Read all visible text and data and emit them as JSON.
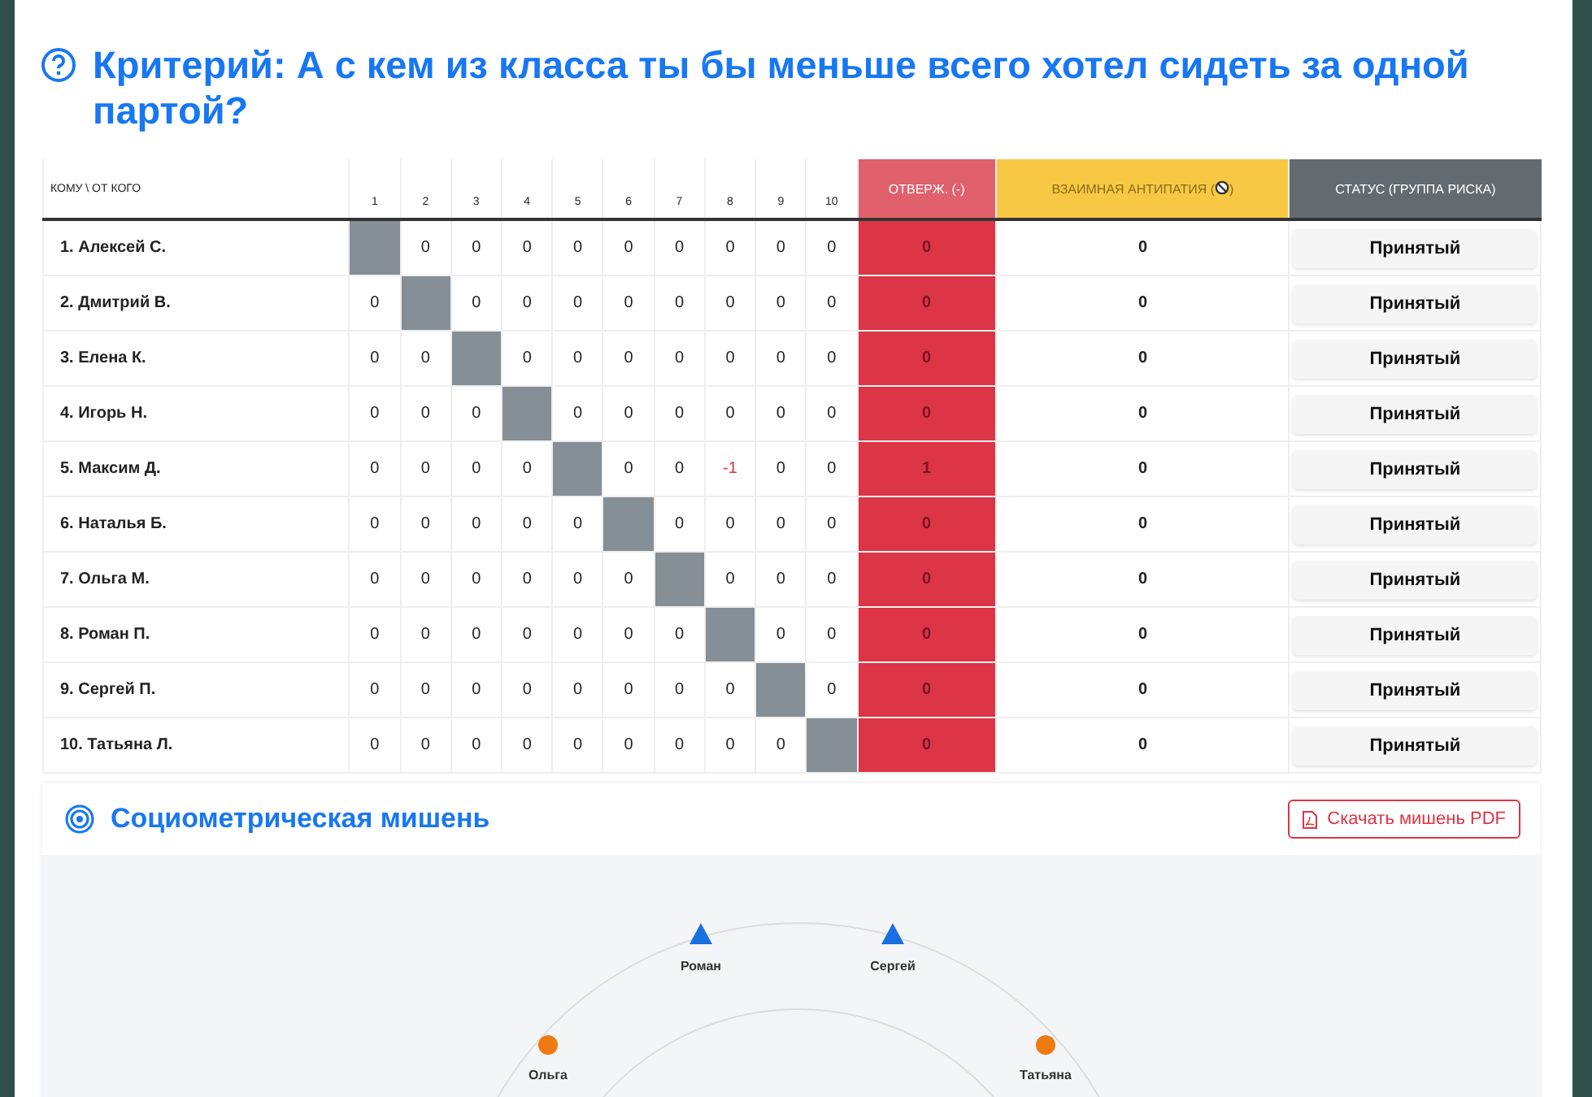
{
  "title": "Критерий: А с кем из класса ты бы меньше всего хотел сидеть за одной партой?",
  "table": {
    "columns": {
      "name": "КОМУ \\ ОТ КОГО",
      "numbers": [
        "1",
        "2",
        "3",
        "4",
        "5",
        "6",
        "7",
        "8",
        "9",
        "10"
      ],
      "rejections": "ОТВЕРЖ. (-)",
      "antipathy": "ВЗАИМНАЯ АНТИПАТИЯ (",
      "antipathy_end": ")",
      "status": "СТАТУС (ГРУППА РИСКА)"
    },
    "rows": [
      {
        "name": "1. Алексей С.",
        "cells": [
          {
            "kind": "self"
          },
          {
            "kind": "value",
            "text": "0"
          },
          {
            "kind": "value",
            "text": "0"
          },
          {
            "kind": "value",
            "text": "0"
          },
          {
            "kind": "value",
            "text": "0"
          },
          {
            "kind": "value",
            "text": "0"
          },
          {
            "kind": "value",
            "text": "0"
          },
          {
            "kind": "value",
            "text": "0"
          },
          {
            "kind": "value",
            "text": "0"
          },
          {
            "kind": "value",
            "text": "0"
          }
        ],
        "rejections": "0",
        "antipathy": "0",
        "status": "Принятый"
      },
      {
        "name": "2. Дмитрий В.",
        "cells": [
          {
            "kind": "value",
            "text": "0"
          },
          {
            "kind": "self"
          },
          {
            "kind": "value",
            "text": "0"
          },
          {
            "kind": "value",
            "text": "0"
          },
          {
            "kind": "value",
            "text": "0"
          },
          {
            "kind": "value",
            "text": "0"
          },
          {
            "kind": "value",
            "text": "0"
          },
          {
            "kind": "value",
            "text": "0"
          },
          {
            "kind": "value",
            "text": "0"
          },
          {
            "kind": "value",
            "text": "0"
          }
        ],
        "rejections": "0",
        "antipathy": "0",
        "status": "Принятый"
      },
      {
        "name": "3. Елена К.",
        "cells": [
          {
            "kind": "value",
            "text": "0"
          },
          {
            "kind": "value",
            "text": "0"
          },
          {
            "kind": "self"
          },
          {
            "kind": "value",
            "text": "0"
          },
          {
            "kind": "value",
            "text": "0"
          },
          {
            "kind": "value",
            "text": "0"
          },
          {
            "kind": "value",
            "text": "0"
          },
          {
            "kind": "value",
            "text": "0"
          },
          {
            "kind": "value",
            "text": "0"
          },
          {
            "kind": "value",
            "text": "0"
          }
        ],
        "rejections": "0",
        "antipathy": "0",
        "status": "Принятый"
      },
      {
        "name": "4. Игорь Н.",
        "cells": [
          {
            "kind": "value",
            "text": "0"
          },
          {
            "kind": "value",
            "text": "0"
          },
          {
            "kind": "value",
            "text": "0"
          },
          {
            "kind": "self"
          },
          {
            "kind": "value",
            "text": "0"
          },
          {
            "kind": "value",
            "text": "0"
          },
          {
            "kind": "value",
            "text": "0"
          },
          {
            "kind": "value",
            "text": "0"
          },
          {
            "kind": "value",
            "text": "0"
          },
          {
            "kind": "value",
            "text": "0"
          }
        ],
        "rejections": "0",
        "antipathy": "0",
        "status": "Принятый"
      },
      {
        "name": "5. Максим Д.",
        "cells": [
          {
            "kind": "value",
            "text": "0"
          },
          {
            "kind": "value",
            "text": "0"
          },
          {
            "kind": "value",
            "text": "0"
          },
          {
            "kind": "value",
            "text": "0"
          },
          {
            "kind": "self"
          },
          {
            "kind": "value",
            "text": "0"
          },
          {
            "kind": "value",
            "text": "0"
          },
          {
            "kind": "negative",
            "text": "-1"
          },
          {
            "kind": "value",
            "text": "0"
          },
          {
            "kind": "value",
            "text": "0"
          }
        ],
        "rejections": "1",
        "antipathy": "0",
        "status": "Принятый"
      },
      {
        "name": "6. Наталья Б.",
        "cells": [
          {
            "kind": "value",
            "text": "0"
          },
          {
            "kind": "value",
            "text": "0"
          },
          {
            "kind": "value",
            "text": "0"
          },
          {
            "kind": "value",
            "text": "0"
          },
          {
            "kind": "value",
            "text": "0"
          },
          {
            "kind": "self"
          },
          {
            "kind": "value",
            "text": "0"
          },
          {
            "kind": "value",
            "text": "0"
          },
          {
            "kind": "value",
            "text": "0"
          },
          {
            "kind": "value",
            "text": "0"
          }
        ],
        "rejections": "0",
        "antipathy": "0",
        "status": "Принятый"
      },
      {
        "name": "7. Ольга М.",
        "cells": [
          {
            "kind": "value",
            "text": "0"
          },
          {
            "kind": "value",
            "text": "0"
          },
          {
            "kind": "value",
            "text": "0"
          },
          {
            "kind": "value",
            "text": "0"
          },
          {
            "kind": "value",
            "text": "0"
          },
          {
            "kind": "value",
            "text": "0"
          },
          {
            "kind": "self"
          },
          {
            "kind": "value",
            "text": "0"
          },
          {
            "kind": "value",
            "text": "0"
          },
          {
            "kind": "value",
            "text": "0"
          }
        ],
        "rejections": "0",
        "antipathy": "0",
        "status": "Принятый"
      },
      {
        "name": "8. Роман П.",
        "cells": [
          {
            "kind": "value",
            "text": "0"
          },
          {
            "kind": "value",
            "text": "0"
          },
          {
            "kind": "value",
            "text": "0"
          },
          {
            "kind": "value",
            "text": "0"
          },
          {
            "kind": "value",
            "text": "0"
          },
          {
            "kind": "value",
            "text": "0"
          },
          {
            "kind": "value",
            "text": "0"
          },
          {
            "kind": "self"
          },
          {
            "kind": "value",
            "text": "0"
          },
          {
            "kind": "value",
            "text": "0"
          }
        ],
        "rejections": "0",
        "antipathy": "0",
        "status": "Принятый"
      },
      {
        "name": "9. Сергей П.",
        "cells": [
          {
            "kind": "value",
            "text": "0"
          },
          {
            "kind": "value",
            "text": "0"
          },
          {
            "kind": "value",
            "text": "0"
          },
          {
            "kind": "value",
            "text": "0"
          },
          {
            "kind": "value",
            "text": "0"
          },
          {
            "kind": "value",
            "text": "0"
          },
          {
            "kind": "value",
            "text": "0"
          },
          {
            "kind": "value",
            "text": "0"
          },
          {
            "kind": "self"
          },
          {
            "kind": "value",
            "text": "0"
          }
        ],
        "rejections": "0",
        "antipathy": "0",
        "status": "Принятый"
      },
      {
        "name": "10. Татьяна Л.",
        "cells": [
          {
            "kind": "value",
            "text": "0"
          },
          {
            "kind": "value",
            "text": "0"
          },
          {
            "kind": "value",
            "text": "0"
          },
          {
            "kind": "value",
            "text": "0"
          },
          {
            "kind": "value",
            "text": "0"
          },
          {
            "kind": "value",
            "text": "0"
          },
          {
            "kind": "value",
            "text": "0"
          },
          {
            "kind": "value",
            "text": "0"
          },
          {
            "kind": "value",
            "text": "0"
          },
          {
            "kind": "self"
          }
        ],
        "rejections": "0",
        "antipathy": "0",
        "status": "Принятый"
      }
    ]
  },
  "target": {
    "title": "Социометрическая мишень",
    "download_button": "Скачать мишень PDF",
    "nodes": [
      {
        "name": "Роман",
        "kind": "triangle",
        "color": "#1a6fe0"
      },
      {
        "name": "Сергей",
        "kind": "triangle",
        "color": "#1a6fe0"
      },
      {
        "name": "Ольга",
        "kind": "circle",
        "color": "#f07a12"
      },
      {
        "name": "Татьяна",
        "kind": "circle",
        "color": "#f07a12"
      }
    ]
  }
}
